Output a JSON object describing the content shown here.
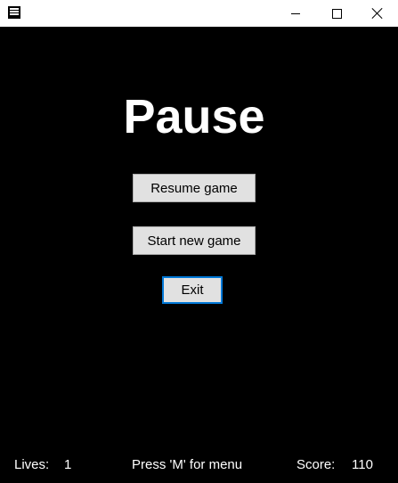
{
  "window": {
    "icon": "app-icon",
    "controls": [
      "minimize-icon",
      "maximize-icon",
      "close-icon"
    ]
  },
  "menu": {
    "title": "Pause",
    "buttons": {
      "resume": "Resume game",
      "new_game": "Start new game",
      "exit": "Exit"
    }
  },
  "status": {
    "lives_label": "Lives:",
    "lives_value": "1",
    "menu_hint": "Press 'M' for menu",
    "score_label": "Score:",
    "score_value": "110"
  },
  "colors": {
    "background": "#000000",
    "text": "#ffffff",
    "button": "#e1e1e1",
    "focus": "#0078d7"
  }
}
